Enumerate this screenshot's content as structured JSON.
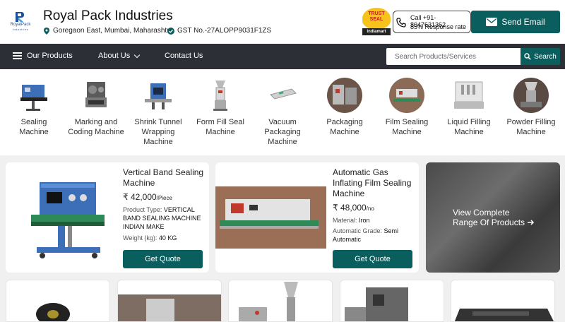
{
  "header": {
    "logo_text": "RoyalPack",
    "logo_subtext": "Industries",
    "company_name": "Royal Pack Industries",
    "address": "Goregaon East, Mumbai, Maharashtra",
    "gst": "GST No.-27ALOPP9031F1ZS",
    "trust_seal": {
      "line1": "TRUST",
      "line2": "SEAL",
      "footer": "indiamart"
    },
    "call": {
      "label": "Call +91-8047631362",
      "response": "85% Response rate"
    },
    "send_email_label": "Send Email"
  },
  "nav": {
    "our_products": "Our Products",
    "about_us": "About Us",
    "contact_us": "Contact Us",
    "search_placeholder": "Search Products/Services",
    "search_button": "Search"
  },
  "categories": [
    {
      "label": "Sealing Machine"
    },
    {
      "label": "Marking and Coding Machine"
    },
    {
      "label": "Shrink Tunnel Wrapping Machine"
    },
    {
      "label": "Form Fill Seal Machine"
    },
    {
      "label": "Vacuum Packaging Machine"
    },
    {
      "label": "Packaging Machine"
    },
    {
      "label": "Film Sealing Machine"
    },
    {
      "label": "Liquid Filling Machine"
    },
    {
      "label": "Powder Filling Machine"
    }
  ],
  "products": [
    {
      "title": "Vertical Band Sealing Machine",
      "price": "₹ 42,000",
      "unit": "/Piece",
      "spec1_label": "Product Type:",
      "spec1_value": "VERTICAL BAND SEALING MACHINE INDIAN MAKE",
      "spec2_label": "Weight (kg):",
      "spec2_value": "40 KG",
      "cta": "Get Quote"
    },
    {
      "title": "Automatic Gas Inflating Film Sealing Machine",
      "price": "₹ 48,000",
      "unit": "/no",
      "spec1_label": "Material:",
      "spec1_value": "Iron",
      "spec2_label": "Automatic Grade:",
      "spec2_value": "Semi Automatic",
      "cta": "Get Quote"
    }
  ],
  "view_all": {
    "line1": "View Complete",
    "line2": "Range Of Products"
  },
  "colors": {
    "brand": "#0b5e5e",
    "nav_bg": "#2c2f36"
  }
}
